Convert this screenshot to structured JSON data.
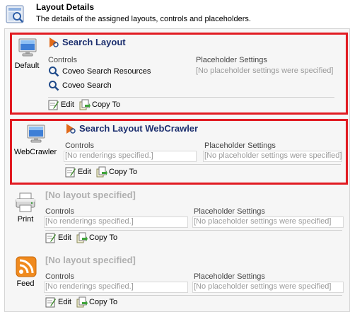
{
  "header": {
    "title": "Layout Details",
    "subtitle": "The details of the assigned layouts, controls and placeholders."
  },
  "labels": {
    "controls": "Controls",
    "placeholder_settings": "Placeholder Settings",
    "edit": "Edit",
    "copy_to": "Copy To",
    "no_renderings": "[No renderings specified.]",
    "no_placeholders": "[No placeholder settings were specified]"
  },
  "devices": [
    {
      "name": "Default",
      "layout": "Search Layout",
      "renderings": [
        "Coveo Search Resources",
        "Coveo Search"
      ]
    },
    {
      "name": "WebCrawler",
      "layout": "Search Layout WebCrawler",
      "renderings": []
    },
    {
      "name": "Print",
      "layout": "[No layout specified]",
      "renderings": []
    },
    {
      "name": "Feed",
      "layout": "[No layout specified]",
      "renderings": []
    }
  ],
  "colors": {
    "highlight": "#e11b22",
    "layout_title": "#1b2e6e",
    "muted": "#9a9a9a"
  },
  "icons": {
    "header": "layout-details-icon",
    "monitor": "monitor-icon",
    "printer": "printer-icon",
    "feed": "rss-feed-icon",
    "layout": "layout-icon",
    "rendering": "magnifier-icon",
    "edit": "edit-icon",
    "copy": "copy-to-icon"
  }
}
